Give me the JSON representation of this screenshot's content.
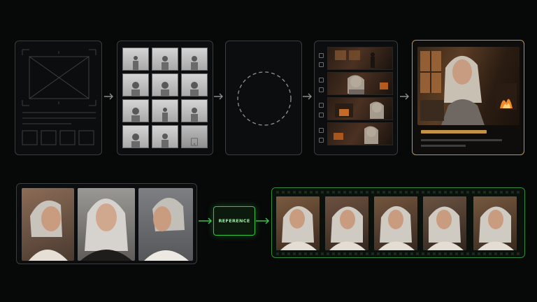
{
  "pipeline": {
    "stages": [
      "wireframe",
      "sketch-grid",
      "placeholder",
      "storyboard",
      "final-render"
    ],
    "accent_color": "#c29346",
    "arrow_color": "#8a8d90"
  },
  "reference": {
    "label": "REFERENCE",
    "color": "#37c24a"
  },
  "portraits": [
    "profile-left",
    "front-facing",
    "profile-right"
  ],
  "film_frames": 5
}
